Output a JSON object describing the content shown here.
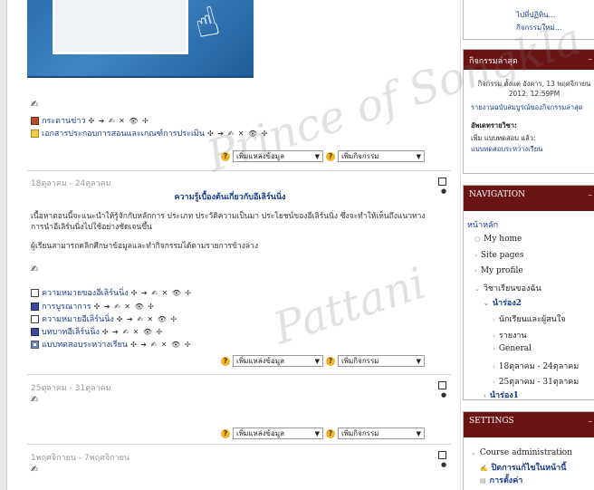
{
  "course": {
    "section0": {
      "items": [
        {
          "label": "กระดานข่าว",
          "icon": "news-forum-icon",
          "tools": "✣ ➔ ✍ ✕ 👁 ✢"
        },
        {
          "label": "เอกสารประกอบการสอนและเกณฑ์การประเมิน",
          "icon": "folder-icon",
          "tools": "✣ ➔ ✍ ✕ 👁 ✢"
        }
      ],
      "add_resource": "เพิ่มแหล่งข้อมูล",
      "add_activity": "เพิ่มกิจกรรม"
    },
    "week1": {
      "title": "18ตุลาคม - 24ตุลาคม",
      "heading": "ความรู้เบื้องต้นเกี่ยวกับอีเลิร์นนิ่ง",
      "para1": "เนื้อหาตอนนี้จะแนะนำให้รู้จักกับหลักการ ประเภท ประวัติความเป็นมา ประโยชน์ของอีเลิร์นนิ่ง ซึ่งจะทำให้เห็นถึงแนวทาง การนำอีเลิร์นนิ่งไปใช้อย่างชัดเจนขึ้น",
      "para2": "ผู้เรียนสามารถคลิกศึกษาข้อมูลและทำกิจกรรมได้ตามรายการข้างล่าง",
      "items": [
        {
          "label": "ความหมายของอีเลิร์นนิ่ง",
          "icon": "page-icon",
          "tools": "✣ ➔ ✍ ✕ 👁 ✢"
        },
        {
          "label": "การบูรณาการ",
          "icon": "book-icon",
          "tools": "✣ ➔ ✍ ✕ 👁 ✢"
        },
        {
          "label": "ความหมายอีเลิร์นนิ่ง",
          "icon": "page-icon",
          "tools": "✣ ➔ ✍ ✕ 👁 ✢"
        },
        {
          "label": "บทบาทอีเลิร์นนิ่ง",
          "icon": "book-icon",
          "tools": "✣ ➔ ✍ ✕ 👁 ✢"
        },
        {
          "label": "แบบทดสอบระหว่างเรียน",
          "icon": "quiz-icon",
          "tools": "✣ ➔ ✍ ✕ 👁 ✢"
        }
      ],
      "add_resource": "เพิ่มแหล่งข้อมูล",
      "add_activity": "เพิ่มกิจกรรม"
    },
    "week2": {
      "title": "25ตุลาคม - 31ตุลาคม",
      "add_resource": "เพิ่มแหล่งข้อมูล",
      "add_activity": "เพิ่มกิจกรรม"
    },
    "week3": {
      "title": "1พฤศจิกายน - 7พฤศจิกายน"
    }
  },
  "sidebar": {
    "top_links": [
      "ไปที่ปฏิทิน...",
      "กิจกรรมใหม่..."
    ],
    "recent": {
      "title": "กิจกรรมล่าสุด",
      "since": "กิจกรรม ตั้งแต่ อังคาร, 13 พฤศจิกายน 2012, 12:59PM",
      "full_report": "รายงานฉบับสมบูรณ์ของกิจกรรมล่าสุด",
      "updates_label": "อัพเดทรายวิชา:",
      "update_line": "เพิ่ม แบบทดสอบ แล้ว:",
      "update_item": "แบบทดสอบระหว่างเรียน"
    },
    "navigation": {
      "title": "NAVIGATION",
      "home": "หน้าหลัก",
      "items": [
        "My home",
        "Site pages",
        "My profile",
        "วิชาเรียนของฉัน"
      ],
      "course": "นำร่อง2",
      "course_items": [
        "นักเรียนและผู้สนใจ",
        "รายงาน",
        "General",
        "18ตุลาคม - 24ตุลาคม",
        "25ตุลาคม - 31ตุลาคม"
      ],
      "other_course": "นำร่อง1"
    },
    "settings": {
      "title": "SETTINGS",
      "admin": "Course administration",
      "turn_off_edit": "ปิดการแก้ไขในหน้านี้",
      "settings_link": "การตั้งค่า"
    }
  },
  "watermark": {
    "text1": "Prince of Songkla",
    "text2": "Pattani"
  },
  "colors": {
    "block_header": "#6b1414",
    "link": "#1a3d8f"
  }
}
